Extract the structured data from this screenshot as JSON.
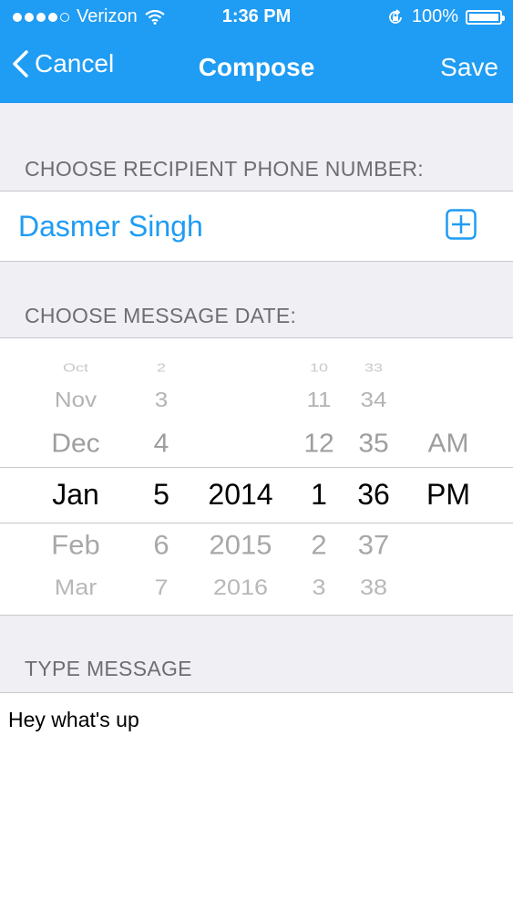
{
  "status_bar": {
    "carrier": "Verizon",
    "time": "1:36 PM",
    "battery": "100%"
  },
  "nav": {
    "back_label": "Cancel",
    "title": "Compose",
    "save_label": "Save"
  },
  "recipient": {
    "header": "CHOOSE RECIPIENT PHONE NUMBER:",
    "name": "Dasmer Singh"
  },
  "date": {
    "header": "CHOOSE MESSAGE DATE:",
    "months": [
      "Oct",
      "Nov",
      "Dec",
      "Jan",
      "Feb",
      "Mar"
    ],
    "days": [
      "2",
      "3",
      "4",
      "5",
      "6",
      "7"
    ],
    "years": [
      "",
      "",
      "",
      "2014",
      "2015",
      "2016"
    ],
    "hours": [
      "10",
      "11",
      "12",
      "1",
      "2",
      "3"
    ],
    "minutes": [
      "33",
      "34",
      "35",
      "36",
      "37",
      "38"
    ],
    "ampm": [
      "",
      "",
      "AM",
      "PM",
      "",
      ""
    ],
    "selected": {
      "month": "Jan",
      "day": "5",
      "year": "2014",
      "hour": "1",
      "minute": "36",
      "ampm": "PM"
    }
  },
  "message": {
    "header": "TYPE MESSAGE",
    "text": "Hey what's up"
  },
  "colors": {
    "accent": "#1f9cf3",
    "group_bg": "#efeff4",
    "header_text": "#6d6d72"
  }
}
